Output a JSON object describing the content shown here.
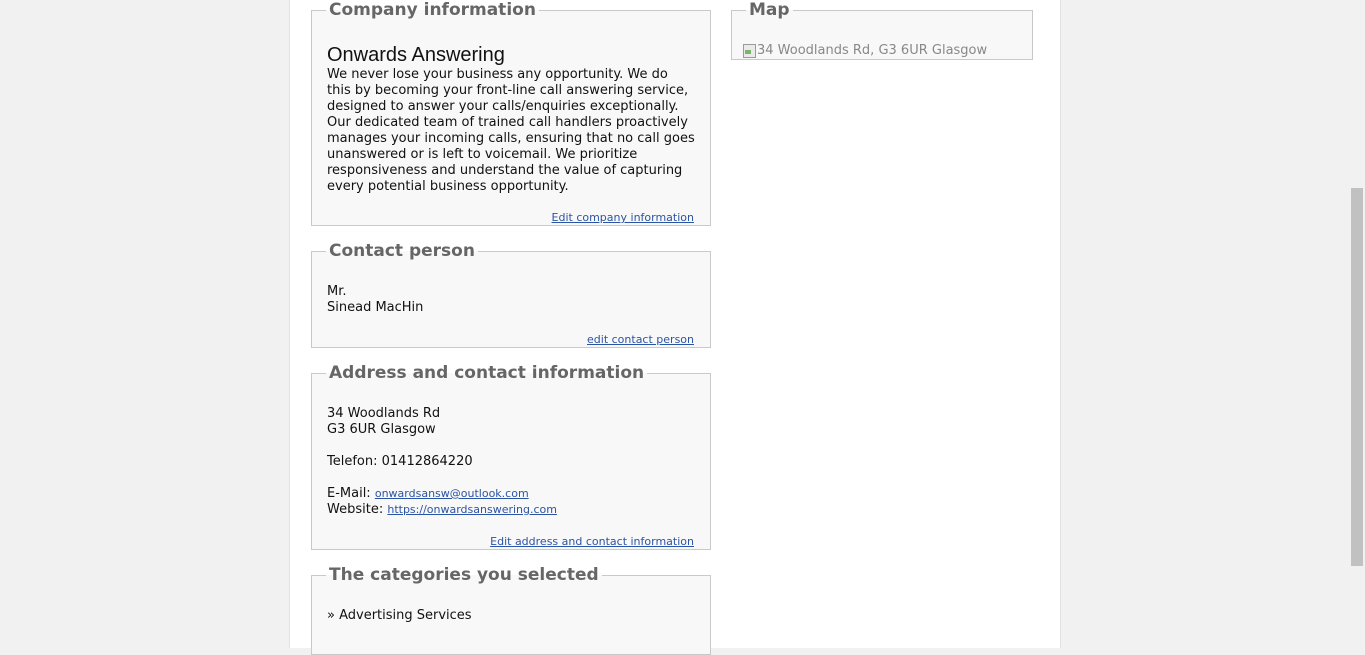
{
  "company": {
    "legend": "Company information",
    "name": "Onwards Answering",
    "description": "We never lose your business any opportunity. We do this by becoming your front-line call answering service, designed to answer your calls/enquiries exceptionally. Our dedicated team of trained call handlers proactively manages your incoming calls, ensuring that no call goes unanswered or is left to voicemail. We prioritize responsiveness and understand the value of capturing every potential business opportunity.",
    "edit_label": "Edit company information"
  },
  "contact": {
    "legend": "Contact person",
    "salutation": "Mr.",
    "name": "Sinead MacHin",
    "edit_label": "edit contact person"
  },
  "address": {
    "legend": "Address and contact information",
    "street": "34 Woodlands Rd",
    "city": "G3 6UR Glasgow",
    "phone_label": "Telefon:",
    "phone": "01412864220",
    "email_label": "E-Mail:",
    "email": "onwardsansw@outlook.com",
    "website_label": "Website:",
    "website": "https://onwardsanswering.com",
    "edit_label": "Edit address and contact information"
  },
  "categories": {
    "legend": "The categories you selected",
    "items": [
      "» Advertising Services"
    ]
  },
  "map": {
    "legend": "Map",
    "alt_text": "34 Woodlands Rd, G3 6UR Glasgow"
  }
}
